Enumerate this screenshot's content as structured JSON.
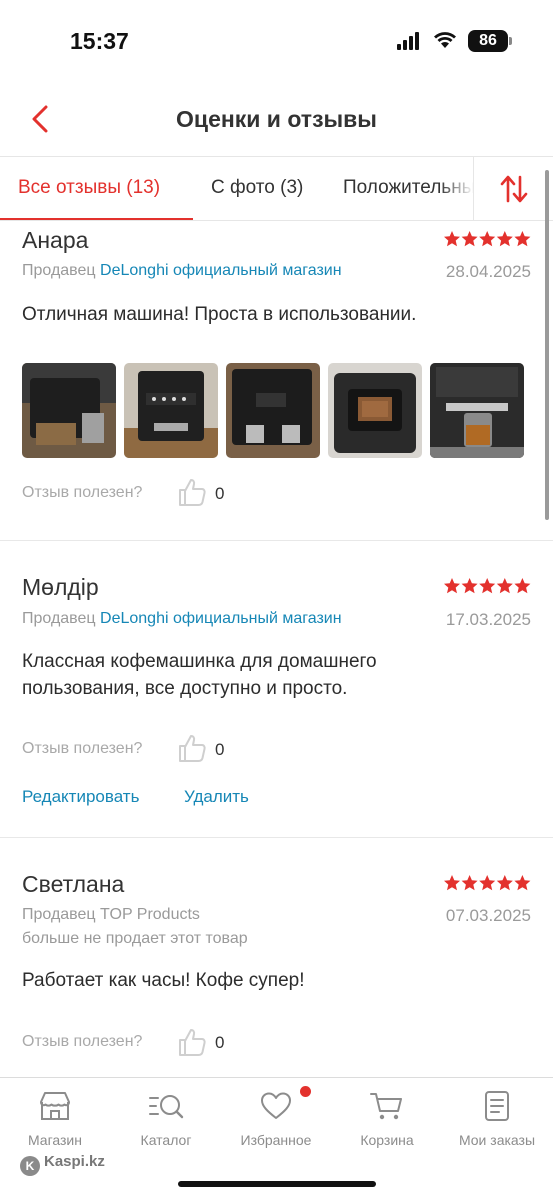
{
  "status_bar": {
    "time": "15:37",
    "battery": "86"
  },
  "header": {
    "title": "Оценки и отзывы"
  },
  "tabs": [
    {
      "label": "Все отзывы (13)"
    },
    {
      "label": "С фото (3)"
    },
    {
      "label": "Положительные"
    }
  ],
  "reviews": [
    {
      "name": "Анара",
      "rating": 5,
      "seller_prefix": "Продавец",
      "seller_name": "DeLonghi официальный магазин",
      "date": "28.04.2025",
      "text": "Отличная машина! Проста в использовании.",
      "photo_count": 5,
      "helpful_label": "Отзыв полезен?",
      "helpful_count": "0"
    },
    {
      "name": "Мөлдір",
      "rating": 5,
      "seller_prefix": "Продавец",
      "seller_name": "DeLonghi официальный магазин",
      "date": "17.03.2025",
      "text": "Классная кофемашинка для домашнего пользования, все доступно и просто.",
      "helpful_label": "Отзыв полезен?",
      "helpful_count": "0",
      "edit_label": "Редактировать",
      "delete_label": "Удалить"
    },
    {
      "name": "Светлана",
      "rating": 5,
      "seller_prefix": "Продавец",
      "seller_name": "TOP Products",
      "seller_note": "больше не продает этот товар",
      "date": "07.03.2025",
      "text": "Работает как часы! Кофе супер!",
      "helpful_label": "Отзыв полезен?",
      "helpful_count": "0"
    }
  ],
  "bottom_nav": [
    {
      "label": "Магазин",
      "icon": "store-icon"
    },
    {
      "label": "Каталог",
      "icon": "catalog-search-icon"
    },
    {
      "label": "Избранное",
      "icon": "heart-icon"
    },
    {
      "label": "Корзина",
      "icon": "cart-icon"
    },
    {
      "label": "Мои заказы",
      "icon": "orders-icon"
    }
  ],
  "watermark": "Kaspi.kz",
  "colors": {
    "accent": "#e3312d",
    "link": "#1687b6",
    "muted": "#9a9a9a"
  }
}
